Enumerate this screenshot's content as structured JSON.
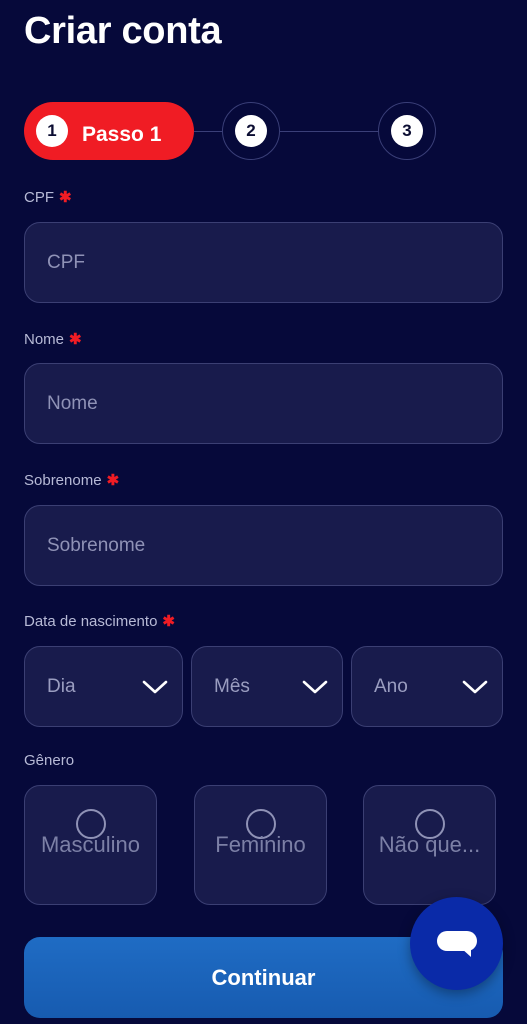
{
  "header": {
    "title": "Criar conta"
  },
  "stepper": {
    "steps": [
      {
        "number": "1",
        "label": "Passo 1",
        "active": true
      },
      {
        "number": "2",
        "active": false
      },
      {
        "number": "3",
        "active": false
      }
    ],
    "active_color": "#f01c24"
  },
  "form": {
    "required_marker": "✱",
    "cpf": {
      "label": "CPF",
      "placeholder": "CPF",
      "value": ""
    },
    "nome": {
      "label": "Nome",
      "placeholder": "Nome",
      "value": ""
    },
    "sobrenome": {
      "label": "Sobrenome",
      "placeholder": "Sobrenome",
      "value": ""
    },
    "birthdate": {
      "label": "Data de nascimento",
      "day": "Dia",
      "month": "Mês",
      "year": "Ano"
    },
    "gender": {
      "label": "Gênero",
      "options": [
        "Masculino",
        "Feminino",
        "Não que..."
      ]
    },
    "submit_label": "Continuar"
  },
  "colors": {
    "background": "#06093a",
    "field_background": "#181b4c",
    "button_blue": "#1f6cc4",
    "required_red": "#f01c24"
  },
  "icons": {
    "select": "chevron-down-icon",
    "chat": "chat-bubble-icon"
  }
}
